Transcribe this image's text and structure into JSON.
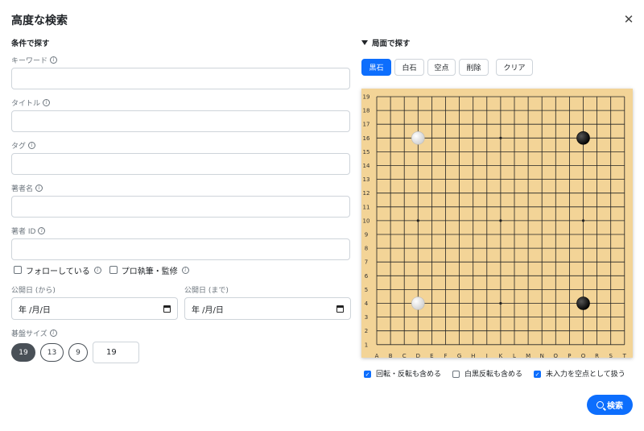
{
  "modal": {
    "title": "高度な検索",
    "close_icon": "close-icon"
  },
  "conditions": {
    "title": "条件で探す",
    "keyword_label": "キーワード",
    "title_label": "タイトル",
    "tag_label": "タグ",
    "author_label": "著者名",
    "author_id_label": "著者 ID",
    "following_label": "フォローしている",
    "pro_label": "プロ執筆・監修",
    "date_from_label": "公開日 (から)",
    "date_to_label": "公開日 (まで)",
    "date_placeholder": "年 /月/日",
    "board_size_label": "碁盤サイズ",
    "size_options": [
      "19",
      "13",
      "9"
    ],
    "selected_size": "19",
    "custom_size": "19"
  },
  "position": {
    "title": "局面で探す",
    "tools": [
      "黒石",
      "白石",
      "空点",
      "削除",
      "クリア"
    ],
    "active_tool": "黒石",
    "board": {
      "size": 19,
      "columns": [
        "A",
        "B",
        "C",
        "D",
        "E",
        "F",
        "G",
        "H",
        "J",
        "K",
        "L",
        "M",
        "N",
        "O",
        "P",
        "Q",
        "R",
        "S",
        "T"
      ],
      "stones": [
        {
          "color": "white",
          "point": "D16"
        },
        {
          "color": "black",
          "point": "Q16"
        },
        {
          "color": "white",
          "point": "D4"
        },
        {
          "color": "black",
          "point": "Q4"
        }
      ],
      "colors": {
        "board": "#f3d497",
        "line": "#222222"
      }
    },
    "options": [
      {
        "label": "回転・反転も含める",
        "checked": true
      },
      {
        "label": "白黒反転も含める",
        "checked": false
      },
      {
        "label": "未入力を空点として扱う",
        "checked": true
      }
    ]
  },
  "search_button": {
    "label": "検索"
  },
  "colors": {
    "primary": "#0d6efd",
    "pill_active": "#495057"
  }
}
